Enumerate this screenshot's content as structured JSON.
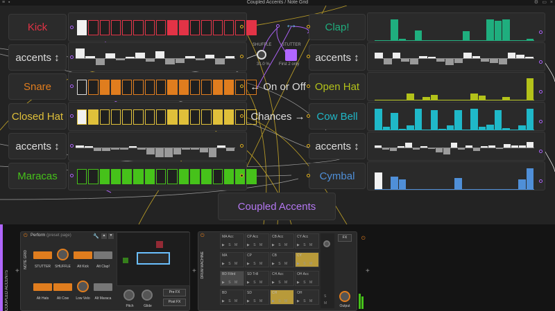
{
  "window": {
    "title": "Coupled Accents / Note Grid"
  },
  "labels": {
    "kick": "Kick",
    "accents": "accents ↕",
    "snare": "Snare",
    "closed_hat": "Closed Hat",
    "maracas": "Maracas",
    "clap": "Clap!",
    "open_hat": "Open Hat",
    "cow_bell": "Cow Bell",
    "cymbal": "Cymbal",
    "on_or_off": "← On or Off",
    "chances": "Chances →",
    "title_box": "Coupled Accents"
  },
  "controls": {
    "shuffle": "SHUFFLE",
    "shuffle_value": "31.0 %",
    "stutter": "STUTTER",
    "stutter_value": "First 2 only"
  },
  "colors": {
    "kick": "#e23346",
    "snare": "#e07d1e",
    "closed_hat": "#e0c03a",
    "maracas": "#46c21a",
    "clap": "#1fae7e",
    "open_hat": "#b3c21a",
    "cow_bell": "#1fb8c8",
    "cymbal": "#4f8fd8",
    "purple": "#b066ff",
    "yellow": "#e0b020"
  },
  "step_patterns": {
    "kick": [
      1,
      0,
      0,
      0,
      0,
      0,
      0,
      0,
      1,
      1,
      0,
      0,
      0,
      0,
      0,
      1
    ],
    "snare": [
      0,
      0,
      1,
      1,
      0,
      0,
      0,
      0,
      1,
      1,
      0,
      0,
      1,
      1,
      0,
      0
    ],
    "closed_hat": [
      1,
      1,
      0,
      0,
      0,
      0,
      0,
      0,
      1,
      1,
      0,
      0,
      1,
      1,
      0,
      0
    ],
    "maracas": [
      0,
      0,
      1,
      1,
      1,
      1,
      1,
      0,
      0,
      1,
      1,
      1,
      0,
      1,
      1,
      1
    ]
  },
  "probabilities": {
    "clap": [
      0,
      0,
      0.9,
      0.1,
      0,
      0.45,
      0,
      0,
      0,
      0,
      0,
      0.4,
      0,
      0,
      0.9,
      0.85,
      0.9,
      0,
      0,
      0.1
    ],
    "open_hat": [
      0,
      0,
      0,
      0,
      0.3,
      0,
      0.15,
      0.25,
      0,
      0,
      0,
      0,
      0.3,
      0.2,
      0,
      0,
      0.15,
      0,
      0,
      0.95
    ],
    "cow_bell": [
      0.9,
      0.15,
      0.75,
      0.05,
      0.2,
      0.9,
      0,
      0.85,
      0.05,
      0.2,
      0.85,
      0,
      0.9,
      0.15,
      0.25,
      0.85,
      0.1,
      0,
      0.2,
      0.9
    ],
    "cymbal": [
      0.75,
      0,
      0.55,
      0.45,
      0,
      0,
      0,
      0,
      0,
      0,
      0.5,
      0,
      0,
      0,
      0,
      0,
      0,
      0,
      0.45,
      0.9
    ]
  },
  "accents": {
    "row1": [
      0.8,
      0.2,
      -0.6,
      0.4,
      -0.2,
      0.1,
      0.5,
      -0.3,
      0.6,
      -0.5,
      -0.4,
      0.2,
      -0.2,
      0.3,
      -0.5,
      0.2
    ],
    "row2": [
      0.5,
      -0.5,
      0.5,
      -0.3,
      -0.5,
      0.2,
      0.1,
      -0.3,
      -0.6,
      -0.4,
      0.5,
      0.2,
      -0.3,
      -0.4,
      -0.5,
      0.5,
      0.3,
      0.1
    ],
    "row3": [
      0.2,
      0,
      -0.3,
      -0.3,
      -0.2,
      -0.2,
      0.1,
      -0.2,
      -0.6,
      -0.8,
      -0.8,
      -0.6,
      -0.2,
      -0.2,
      -0.4,
      -0.8,
      0.2,
      -0.3
    ],
    "row4": [
      0.2,
      -0.2,
      -0.3,
      0.1,
      0.4,
      -0.2,
      0.1,
      -0.1,
      -0.4,
      -0.6,
      0.4,
      -0.2,
      0.2,
      -0.3,
      0.1,
      0.2,
      -0.1,
      0.3,
      0.2,
      0.2,
      0.5
    ]
  },
  "device_panel": {
    "side_label": "COUPLED ACCENTS",
    "sub_label": "NOTE GRID",
    "preset": "Perform",
    "preset_note": "(preset page)",
    "macros": [
      "STUTTER",
      "SHUFFLE",
      "Alt Kick",
      "Alt Clap!",
      "Alt Hats",
      "Alt Cow",
      "Low Velo",
      "Alt Maraca"
    ],
    "knobs": [
      "Pitch",
      "Glide"
    ],
    "fx_buttons": [
      "Pre FX",
      "Post FX"
    ]
  },
  "drum_machine": {
    "side_label": "DRUM MACHINE",
    "pads": [
      "MA Acc",
      "CP Acc",
      "CB Acc",
      "CY Acc",
      "MA",
      "CP",
      "CB",
      "CY",
      "BD Filtrd",
      "SD Trill",
      "CH Acc",
      "OH Acc",
      "BD",
      "SD",
      "CH",
      "OH"
    ],
    "cell_controls": "▶ S M",
    "fx": "FX",
    "output": "Output",
    "s": "S",
    "m": "M"
  }
}
